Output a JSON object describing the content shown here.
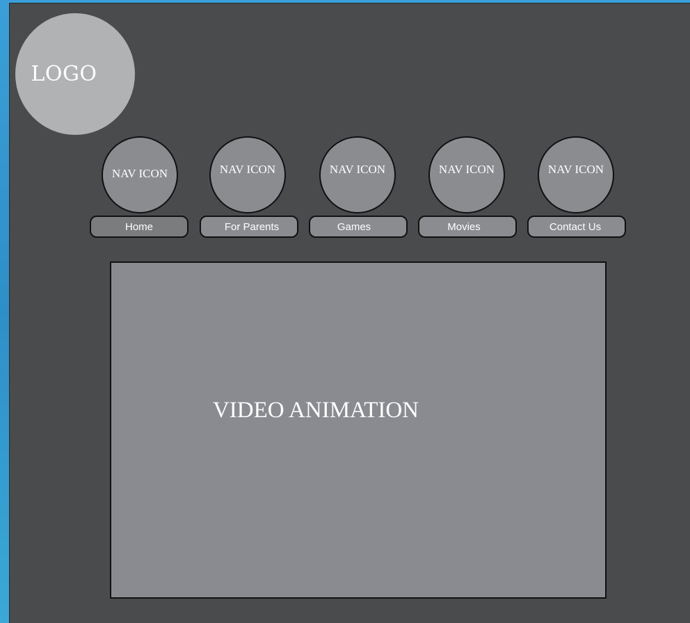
{
  "logo": {
    "label": "LOGO"
  },
  "nav": {
    "icon_label": "NAV ICON",
    "items": [
      {
        "label": "Home"
      },
      {
        "label": "For Parents"
      },
      {
        "label": "Games"
      },
      {
        "label": "Movies"
      },
      {
        "label": "Contact Us"
      }
    ]
  },
  "video": {
    "label": "VIDEO ANIMATION"
  },
  "colors": {
    "outer_background": "#3a9fd8",
    "page_background": "#4a4b4d",
    "logo_fill": "#b1b2b4",
    "element_fill": "#8a8c90",
    "active_fill": "#7b7c7e",
    "text": "#ffffff"
  }
}
